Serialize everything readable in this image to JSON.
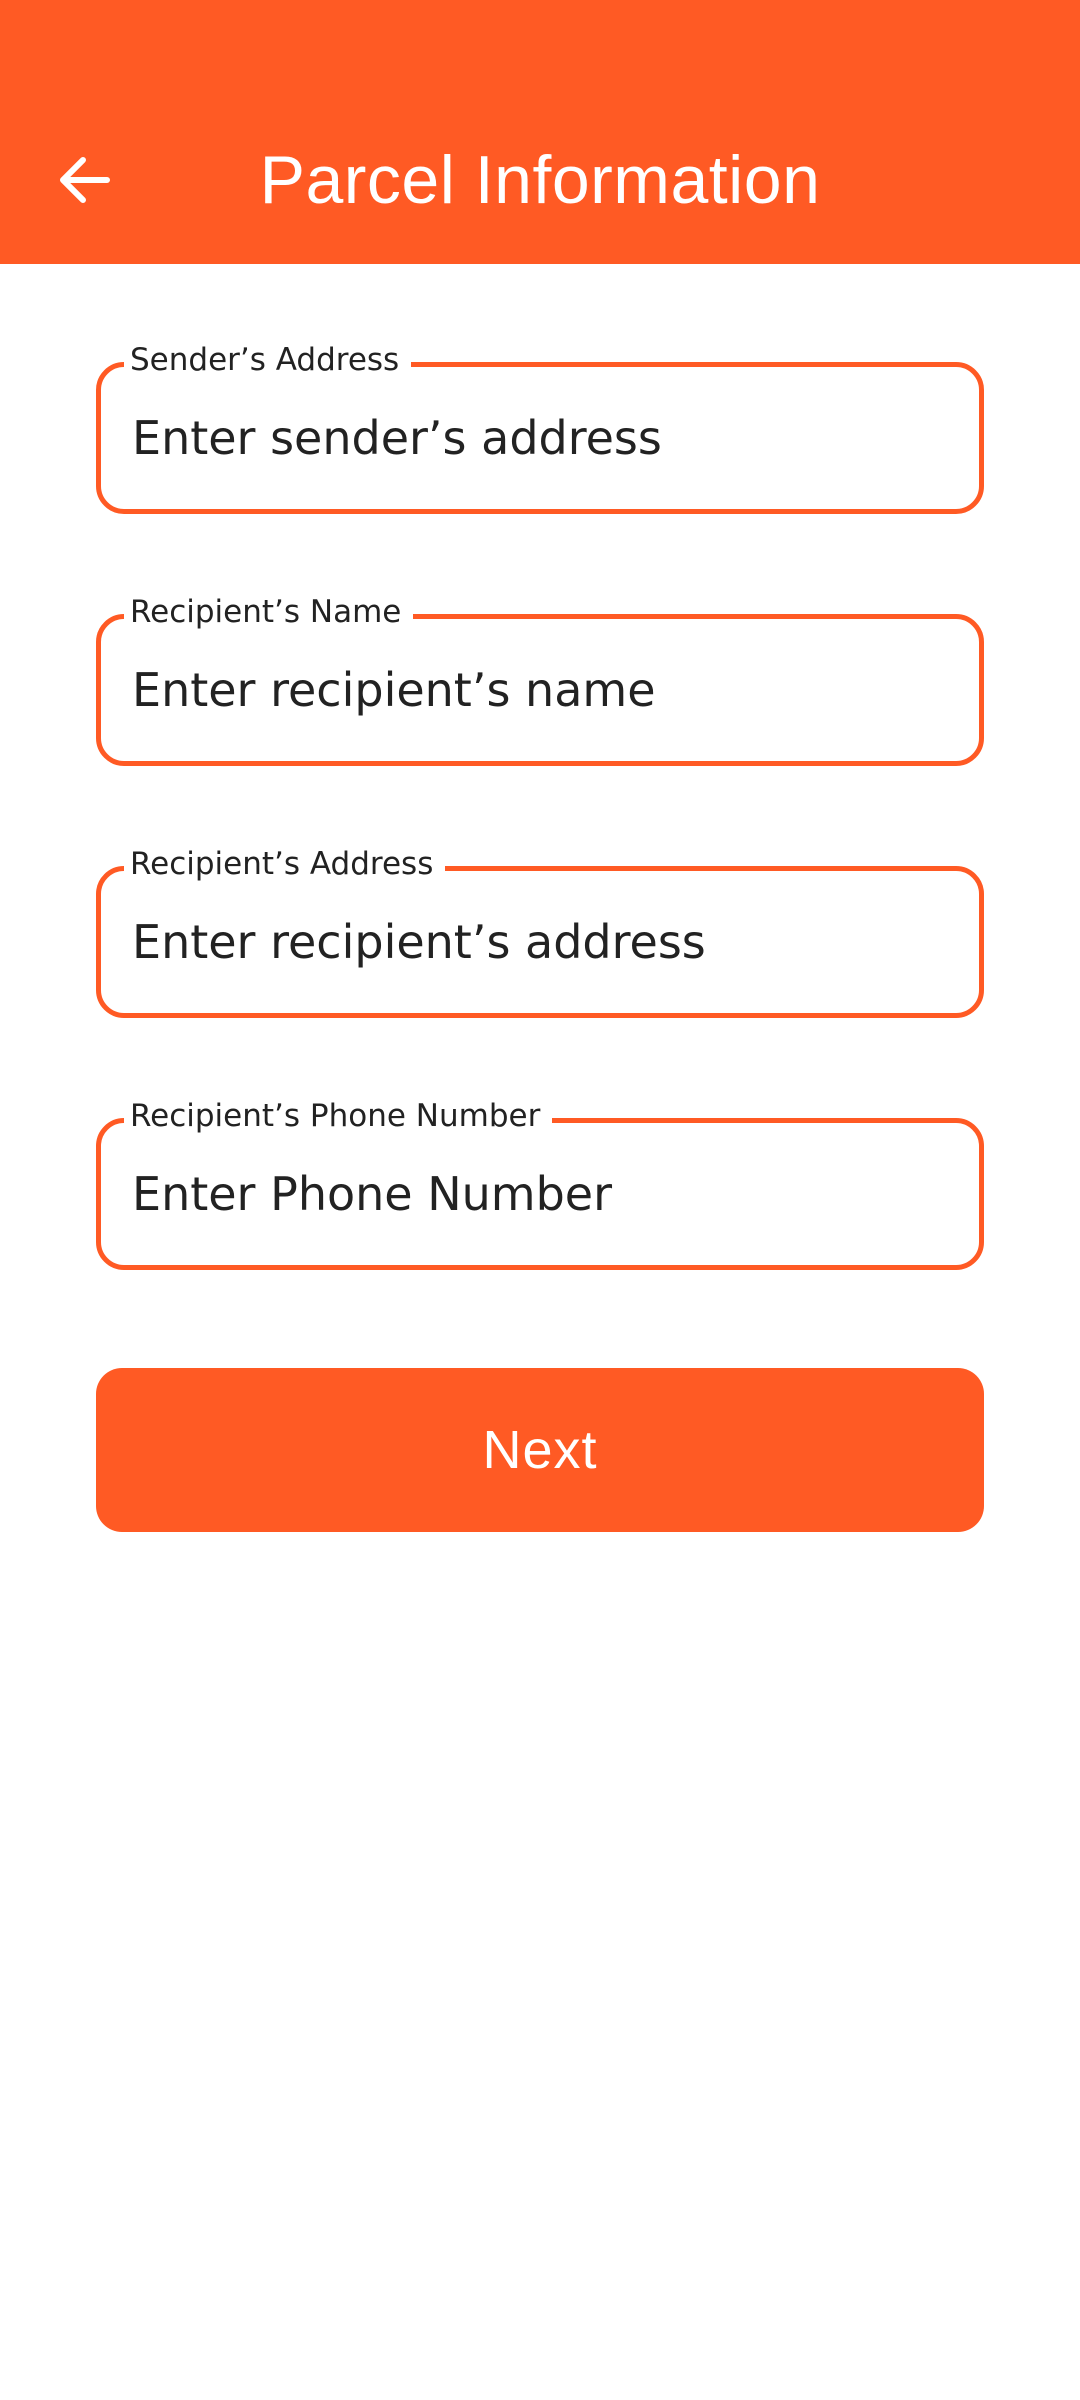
{
  "app_bar": {
    "title": "Parcel Information",
    "back_icon": "arrow-left-icon",
    "background_color": "#FF5A24",
    "text_color": "#FFFFFF"
  },
  "form": {
    "fields": [
      {
        "label": "Sender’s Address",
        "placeholder": "Enter sender’s address",
        "value": ""
      },
      {
        "label": "Recipient’s Name",
        "placeholder": "Enter recipient’s name",
        "value": ""
      },
      {
        "label": "Recipient’s Address",
        "placeholder": "Enter recipient’s address",
        "value": ""
      },
      {
        "label": "Recipient’s Phone Number",
        "placeholder": "Enter Phone Number",
        "value": ""
      }
    ],
    "accent_color": "#FF5A24",
    "next_label": "Next"
  }
}
